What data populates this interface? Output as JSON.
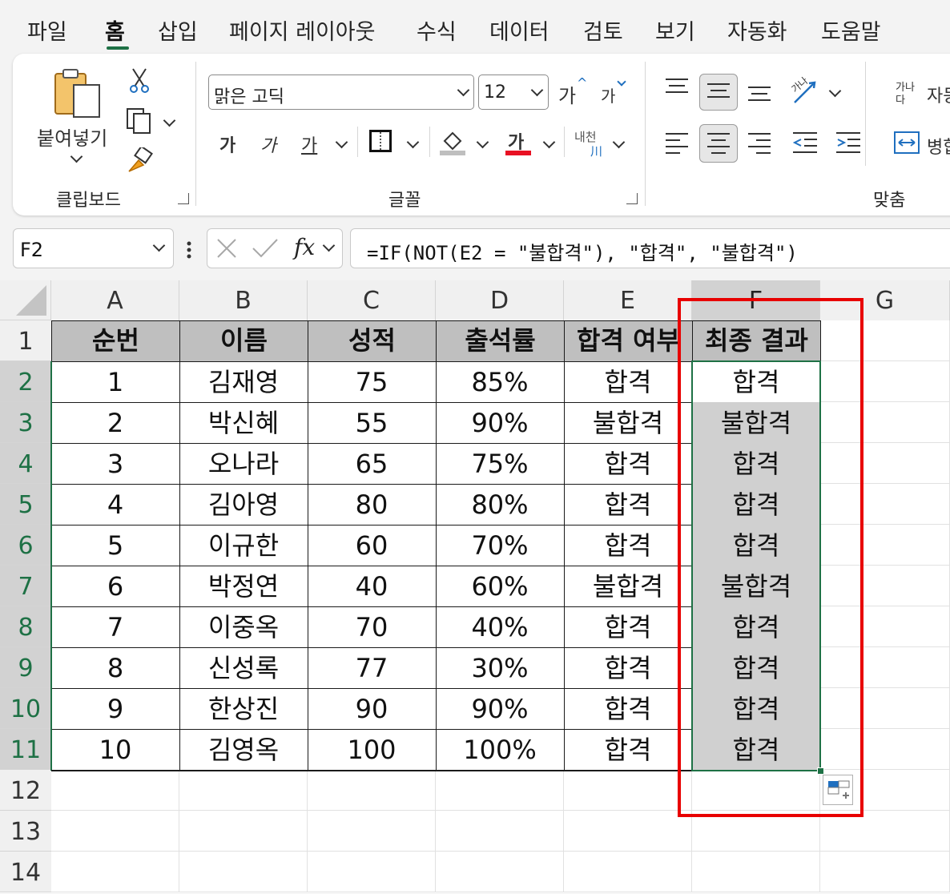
{
  "menu": [
    "파일",
    "홈",
    "삽입",
    "페이지 레이아웃",
    "수식",
    "데이터",
    "검토",
    "보기",
    "자동화",
    "도움말"
  ],
  "ribbon": {
    "clipboard": {
      "paste_label": "붙여넣기",
      "group_label": "클립보드"
    },
    "font": {
      "font_name": "맑은 고딕",
      "font_size": "12",
      "grow_label": "가",
      "shrink_label": "가",
      "bold_label": "가",
      "italic_label": "가",
      "underline_label": "가",
      "font_color_label": "가",
      "phonetic_top": "내천",
      "phonetic_bottom": "川",
      "group_label": "글꼴",
      "font_color": "#e81123"
    },
    "alignment": {
      "wrap_top": "가나",
      "wrap_bottom": "다",
      "wrap_label": "자동",
      "merge_label": "병합",
      "group_label": "맞춤"
    }
  },
  "formula_bar": {
    "name_box": "F2",
    "formula": "=IF(NOT(E2 = \"불합격\"), \"합격\", \"불합격\")",
    "fx_label": "fx"
  },
  "sheet": {
    "columns": [
      "A",
      "B",
      "C",
      "D",
      "E",
      "F",
      "G"
    ],
    "rows": [
      "1",
      "2",
      "3",
      "4",
      "5",
      "6",
      "7",
      "8",
      "9",
      "10",
      "11",
      "12",
      "13",
      "14"
    ],
    "headers": [
      "순번",
      "이름",
      "성적",
      "출석률",
      "합격 여부",
      "최종 결과"
    ],
    "data": [
      [
        "1",
        "김재영",
        "75",
        "85%",
        "합격",
        "합격"
      ],
      [
        "2",
        "박신혜",
        "55",
        "90%",
        "불합격",
        "불합격"
      ],
      [
        "3",
        "오나라",
        "65",
        "75%",
        "합격",
        "합격"
      ],
      [
        "4",
        "김아영",
        "80",
        "80%",
        "합격",
        "합격"
      ],
      [
        "5",
        "이규한",
        "60",
        "70%",
        "합격",
        "합격"
      ],
      [
        "6",
        "박정연",
        "40",
        "60%",
        "불합격",
        "불합격"
      ],
      [
        "7",
        "이중옥",
        "70",
        "40%",
        "합격",
        "합격"
      ],
      [
        "8",
        "신성록",
        "77",
        "30%",
        "합격",
        "합격"
      ],
      [
        "9",
        "한상진",
        "90",
        "90%",
        "합격",
        "합격"
      ],
      [
        "10",
        "김영옥",
        "100",
        "100%",
        "합격",
        "합격"
      ]
    ]
  },
  "colors": {
    "accent": "#1e7145",
    "highlight": "#e80000",
    "header_fill": "#bfbfbf",
    "selection_fill": "#d0d0d0"
  }
}
